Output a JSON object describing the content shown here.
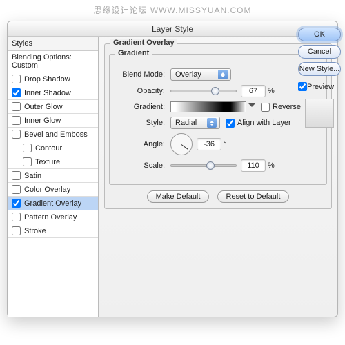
{
  "watermark": "思缘设计论坛    WWW.MISSYUAN.COM",
  "title": "Layer Style",
  "sidebar": {
    "header": "Styles",
    "blending": "Blending Options: Custom",
    "items": [
      {
        "label": "Drop Shadow",
        "checked": false
      },
      {
        "label": "Inner Shadow",
        "checked": true
      },
      {
        "label": "Outer Glow",
        "checked": false
      },
      {
        "label": "Inner Glow",
        "checked": false
      },
      {
        "label": "Bevel and Emboss",
        "checked": false
      },
      {
        "label": "Contour",
        "checked": false,
        "indent": true
      },
      {
        "label": "Texture",
        "checked": false,
        "indent": true
      },
      {
        "label": "Satin",
        "checked": false
      },
      {
        "label": "Color Overlay",
        "checked": false
      },
      {
        "label": "Gradient Overlay",
        "checked": true,
        "selected": true
      },
      {
        "label": "Pattern Overlay",
        "checked": false
      },
      {
        "label": "Stroke",
        "checked": false
      }
    ]
  },
  "panel": {
    "group_title": "Gradient Overlay",
    "inner_title": "Gradient",
    "blend_label": "Blend Mode:",
    "blend_value": "Overlay",
    "opacity_label": "Opacity:",
    "opacity_value": "67",
    "pct": "%",
    "gradient_label": "Gradient:",
    "reverse_label": "Reverse",
    "style_label": "Style:",
    "style_value": "Radial",
    "align_label": "Align with Layer",
    "angle_label": "Angle:",
    "angle_value": "-36",
    "deg": "°",
    "scale_label": "Scale:",
    "scale_value": "110",
    "make_default": "Make Default",
    "reset_default": "Reset to Default"
  },
  "buttons": {
    "ok": "OK",
    "cancel": "Cancel",
    "newstyle": "New Style...",
    "preview": "Preview"
  }
}
